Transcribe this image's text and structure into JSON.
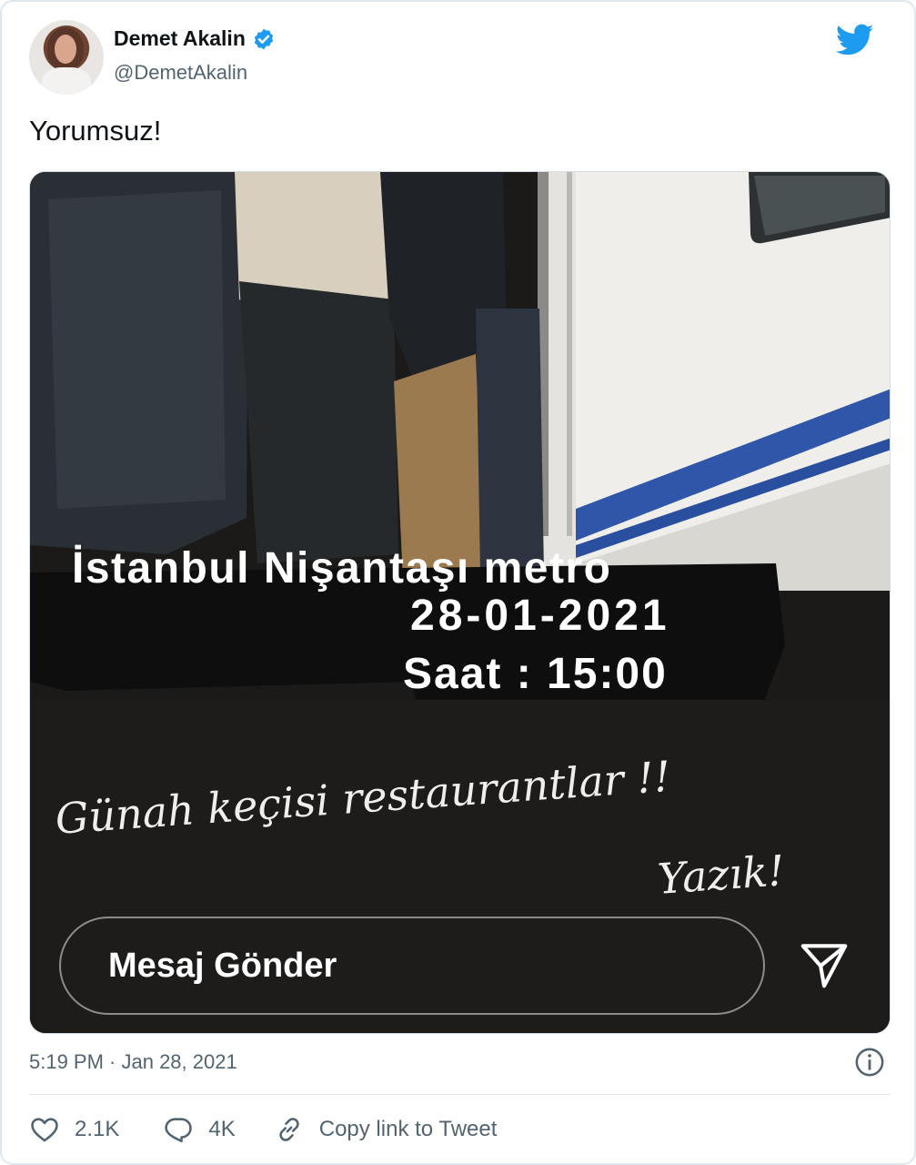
{
  "author": {
    "name": "Demet Akalin",
    "handle": "@DemetAkalin",
    "verified": true
  },
  "tweet": {
    "text": "Yorumsuz!",
    "timestamp": "5:19 PM · Jan 28, 2021"
  },
  "media": {
    "story_lines": [
      "İstanbul Nişantaşı metro",
      "28-01-2021",
      "Saat : 15:00"
    ],
    "script_lines": [
      "Günah keçisi restaurantlar !!",
      "Yazık!"
    ],
    "message_placeholder": "Mesaj Gönder"
  },
  "actions": {
    "likes": "2.1K",
    "replies": "4K",
    "copy_link": "Copy link to Tweet"
  },
  "colors": {
    "twitter_blue": "#1d9bf0",
    "muted_text": "#536471"
  },
  "icons": [
    "twitter-bird-icon",
    "verified-badge-icon",
    "send-arrow-icon",
    "info-icon",
    "heart-icon",
    "reply-bubble-icon",
    "link-icon"
  ]
}
